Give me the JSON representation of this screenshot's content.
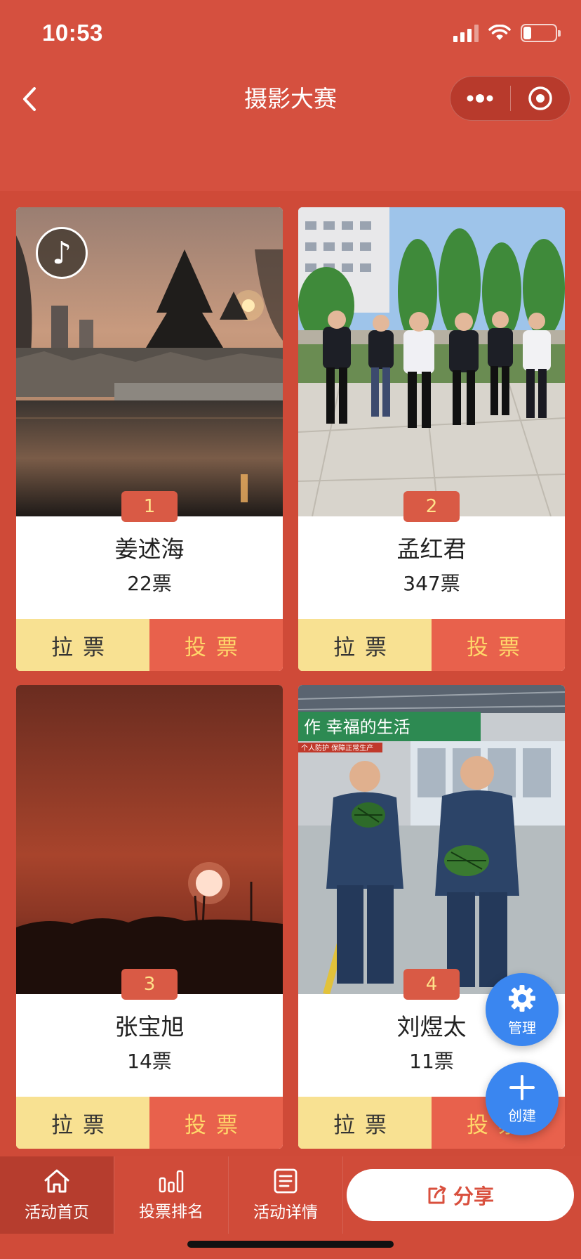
{
  "status_bar": {
    "time": "10:53"
  },
  "header": {
    "title": "摄影大赛"
  },
  "entries": [
    {
      "rank": "1",
      "name": "姜述海",
      "votes": "22票"
    },
    {
      "rank": "2",
      "name": "孟红君",
      "votes": "347票"
    },
    {
      "rank": "3",
      "name": "张宝旭",
      "votes": "14票"
    },
    {
      "rank": "4",
      "name": "刘煜太",
      "votes": "11票"
    }
  ],
  "card_actions": {
    "canvass_label": "拉票",
    "vote_label": "投票"
  },
  "photo4_banner": {
    "slogan": "作 幸福的生活",
    "small_text": "个人防护 保障正常生产"
  },
  "fabs": {
    "manage_label": "管理",
    "create_label": "创建"
  },
  "tabbar": {
    "items": [
      {
        "label": "活动首页",
        "icon": "home-icon",
        "active": true
      },
      {
        "label": "投票排名",
        "icon": "bar-chart-icon",
        "active": false
      },
      {
        "label": "活动详情",
        "icon": "document-icon",
        "active": false
      }
    ],
    "share_label": "分享"
  },
  "colors": {
    "primary": "#d5503f",
    "badge": "#d95a45",
    "canvass_bg": "#f8e192",
    "vote_bg": "#e8614c",
    "vote_text": "#ffd76a",
    "fab_blue": "#3a86f0"
  }
}
